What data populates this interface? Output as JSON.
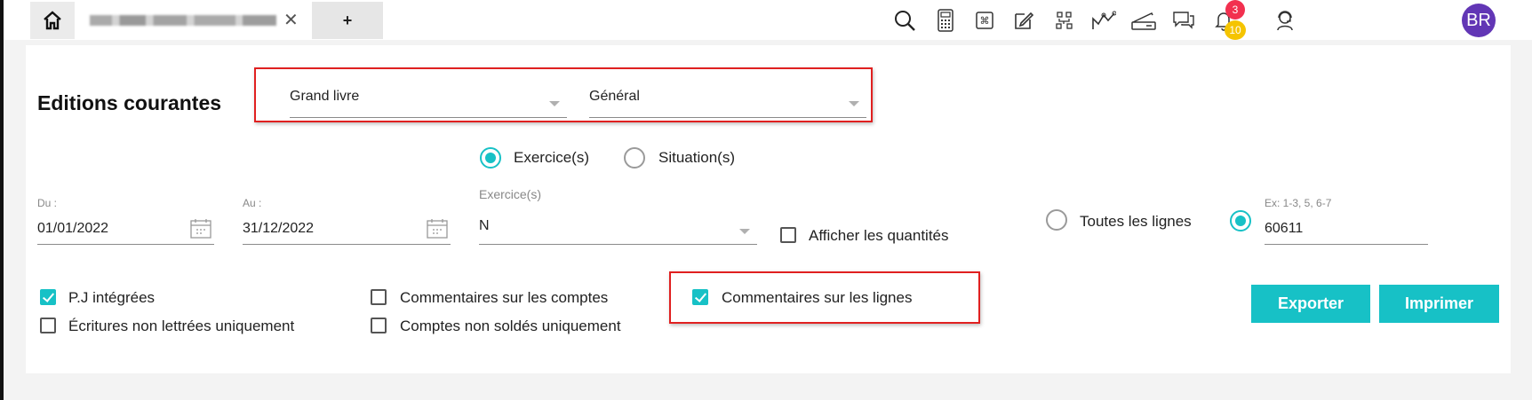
{
  "tabs": {
    "add_label": "+"
  },
  "notifications": {
    "red_count": "3",
    "yellow_count": "10"
  },
  "user": {
    "initials": "BR"
  },
  "page": {
    "title": "Editions courantes"
  },
  "report": {
    "type": "Grand livre",
    "subtype": "Général"
  },
  "mode": {
    "exercise_label": "Exercice(s)",
    "situation_label": "Situation(s)",
    "selected": "exercise"
  },
  "dates": {
    "from_label": "Du :",
    "from_value": "01/01/2022",
    "to_label": "Au :",
    "to_value": "31/12/2022"
  },
  "exercise": {
    "label": "Exercice(s)",
    "value": "N"
  },
  "options": {
    "show_quantities": "Afficher les quantités",
    "all_lines": "Toutes les lignes",
    "lines_hint": "Ex: 1-3, 5, 6-7",
    "lines_value": "60611",
    "pj": "P.J intégrées",
    "unlettered": "Écritures non lettrées uniquement",
    "account_comments": "Commentaires sur les comptes",
    "unbalanced": "Comptes non soldés uniquement",
    "line_comments": "Commentaires sur les lignes"
  },
  "actions": {
    "export": "Exporter",
    "print": "Imprimer"
  },
  "colors": {
    "accent": "#17c1c6",
    "highlight": "#e02020",
    "avatar": "#6236b5"
  }
}
